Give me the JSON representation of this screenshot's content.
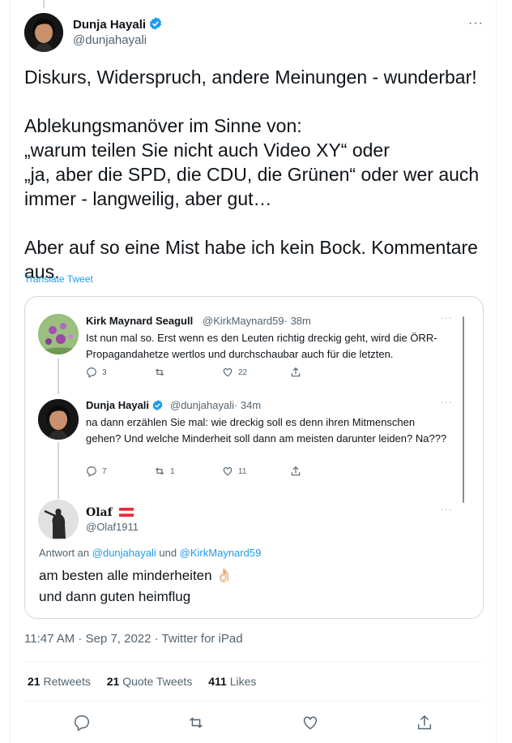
{
  "author": {
    "name": "Dunja Hayali",
    "handle": "@dunjahayali",
    "more": "···"
  },
  "tweet": {
    "text": "Diskurs, Widerspruch, andere Meinungen - wunderbar!\n\nAblekungsmanöver im Sinne von:\n„warum teilen Sie nicht auch Video XY“ oder\n„ja, aber die SPD, die CDU, die Grünen“ oder wer auch immer - langweilig, aber gut…\n\nAber auf so eine Mist habe ich kein Bock. Kommentare aus.",
    "translate": "Translate Tweet"
  },
  "quote": {
    "tweets": [
      {
        "name": "Kirk Maynard Seagull",
        "handle": "@KirkMaynard59",
        "time": "· 38m",
        "text": "Ist nun mal so. Erst wenn es den Leuten richtig dreckig geht, wird die ÖRR-Propagandahetze wertlos und durchschaubar auch für die letzten.",
        "replies": "3",
        "retweets": "",
        "likes": "22"
      },
      {
        "name": "Dunja Hayali",
        "handle": "@dunjahayali",
        "time": "· 34m",
        "text": "na dann erzählen Sie mal: wie dreckig soll es denn ihren Mitmenschen gehen? Und welche Minderheit soll dann am meisten darunter leiden? Na???",
        "replies": "7",
        "retweets": "1",
        "likes": "11"
      }
    ],
    "olaf": {
      "name": "Olaf",
      "handle": "@Olaf1911",
      "reply_prefix": "Antwort an ",
      "reply_user1": "@dunjahayali",
      "reply_and": " und ",
      "reply_user2": "@KirkMaynard59",
      "text": "am besten alle minderheiten 👌🏻\nund dann guten heimflug"
    }
  },
  "meta": {
    "timestamp": "11:47 AM · Sep 7, 2022 · Twitter for iPad"
  },
  "stats": {
    "retweets_count": "21",
    "retweets_label": "Retweets",
    "quotes_count": "21",
    "quotes_label": "Quote Tweets",
    "likes_count": "411",
    "likes_label": "Likes"
  },
  "colors": {
    "accent": "#1d9bf0",
    "text": "#0f1419",
    "muted": "#536471",
    "border": "#cfd9de"
  }
}
